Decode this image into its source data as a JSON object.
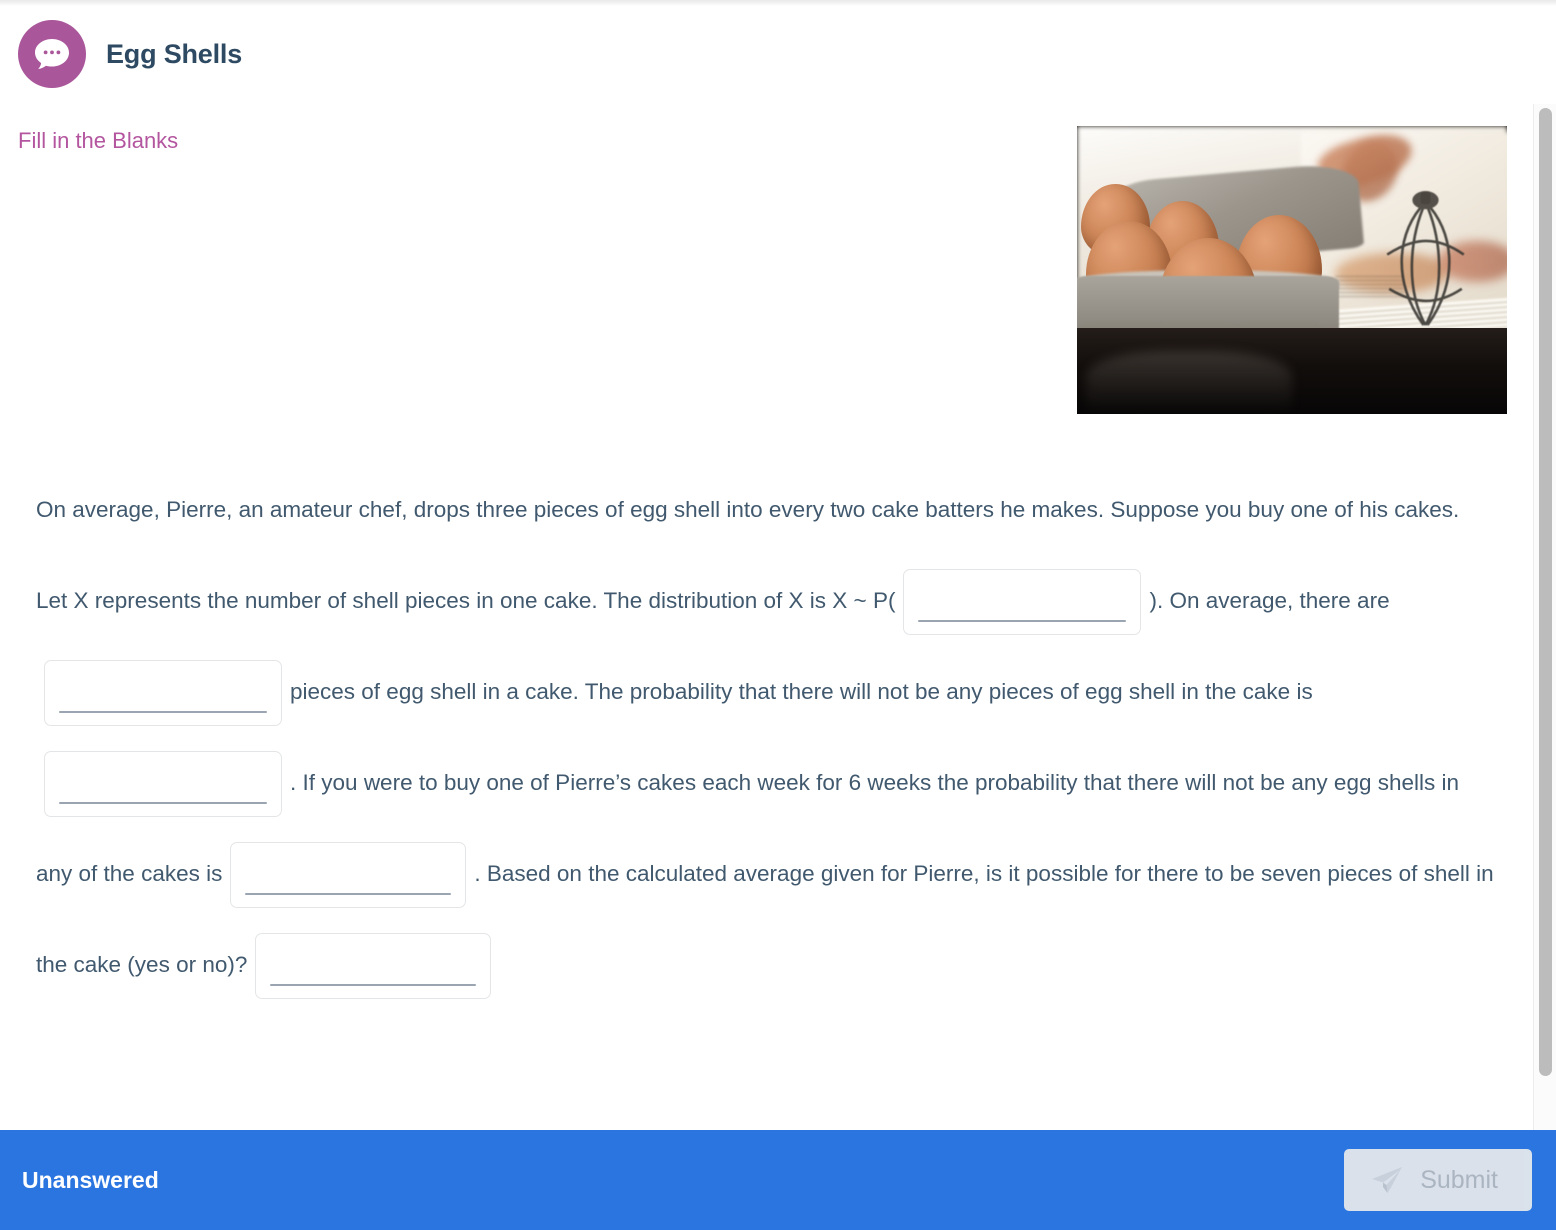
{
  "header": {
    "title": "Egg Shells",
    "icon": "chat-bubble-icon",
    "icon_color": "#a9569a",
    "title_color": "#2e4a63"
  },
  "section": {
    "label": "Fill in the Blanks",
    "label_color": "#b4569f"
  },
  "media": {
    "alt": "Brown eggs in a cardboard egg carton beside an open cookbook and a whisk",
    "name": "egg-carton-photo"
  },
  "question": {
    "text_color": "#41596e",
    "segments": [
      "On average, Pierre, an amateur chef, drops three pieces of egg shell into every two cake batters he makes. Suppose you buy one of his cakes. Let X represents the number of shell pieces in one cake.",
      "The distribution of X is X ~ P(",
      "). On average, there are",
      "pieces of egg shell in a cake. The probability that there will not be any pieces of egg shell in the cake is",
      ".",
      "If you were to buy one of Pierre’s cakes each week for 6 weeks the probability that there will not be any egg shells in any of the cakes is",
      ". Based on the calculated average given for Pierre, is it possible for there to be seven pieces of shell in the cake (yes or no)?"
    ],
    "blanks": [
      {
        "name": "blank-distribution-parameter",
        "value": "",
        "placeholder": ""
      },
      {
        "name": "blank-average-pieces",
        "value": "",
        "placeholder": ""
      },
      {
        "name": "blank-probability-zero",
        "value": "",
        "placeholder": ""
      },
      {
        "name": "blank-probability-six-weeks",
        "value": "",
        "placeholder": ""
      },
      {
        "name": "blank-seven-pieces-yes-no",
        "value": "",
        "placeholder": ""
      }
    ]
  },
  "scrollbar": {
    "name": "vertical-scrollbar",
    "thumb_color": "#bcbcbc"
  },
  "footer": {
    "status": "Unanswered",
    "submit_label": "Submit",
    "submit_icon": "send-icon",
    "bar_color": "#2a75e0",
    "submit_disabled": true
  }
}
